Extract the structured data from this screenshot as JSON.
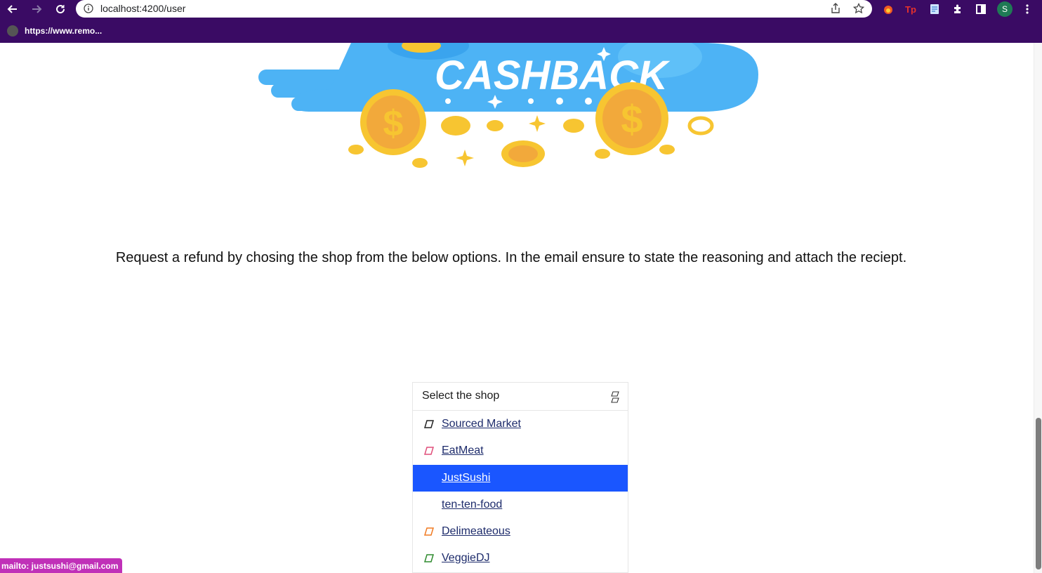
{
  "browser": {
    "url": "localhost:4200/user",
    "bookmark": "https://www.remo...",
    "profile_initial": "S",
    "icons": [
      "back-icon",
      "forward-icon",
      "reload-icon",
      "info-icon",
      "share-icon",
      "star-icon",
      "extension-fire-icon",
      "extension-tp-icon",
      "extension-note-icon",
      "puzzle-icon",
      "sidepanel-icon",
      "menu-icon"
    ]
  },
  "banner": {
    "text": "CASHBACK",
    "colors": {
      "cloud": "#4db3f5",
      "coin": "#f7c531",
      "coin_inner": "#f2a93b"
    }
  },
  "instruction": "Request a refund by chosing the shop from the below options. In the email ensure to state the reasoning and attach the reciept.",
  "dropdown": {
    "label": "Select the shop",
    "options": [
      {
        "name": "Sourced Market",
        "mark_color": "#222222",
        "selected": false
      },
      {
        "name": "EatMeat",
        "mark_color": "#e04e7a",
        "selected": false
      },
      {
        "name": "JustSushi",
        "mark_color": "",
        "selected": true
      },
      {
        "name": "ten-ten-food",
        "mark_color": "",
        "selected": false
      },
      {
        "name": "Delimeateous",
        "mark_color": "#f07a22",
        "selected": false
      },
      {
        "name": "VeggieDJ",
        "mark_color": "#2e8b2e",
        "selected": false
      }
    ],
    "selected_color": "#1a56ff"
  },
  "status": "mailto: justsushi@gmail.com"
}
